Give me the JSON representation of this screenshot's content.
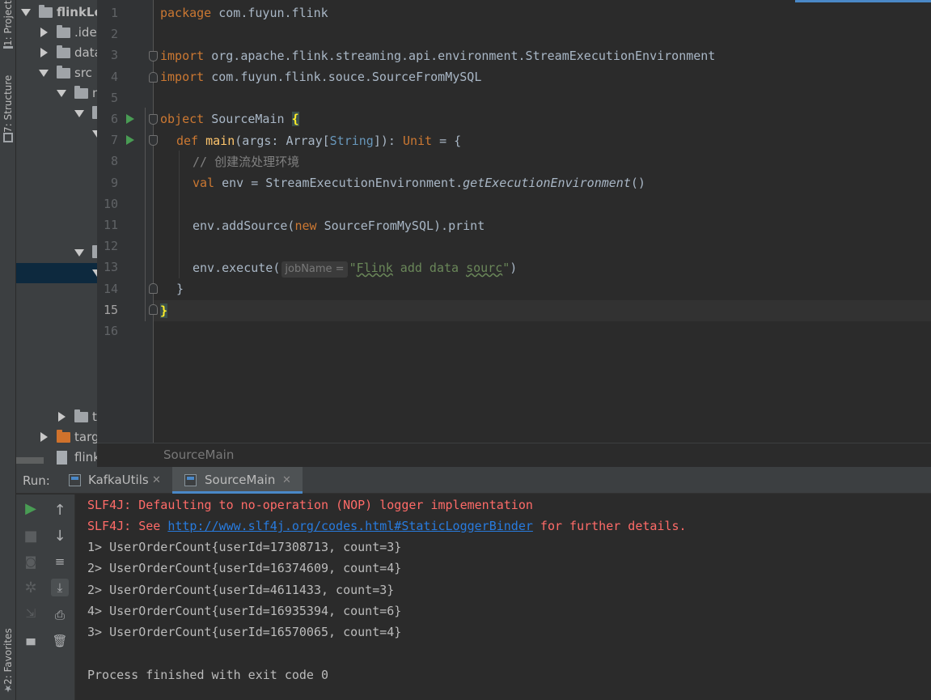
{
  "left_strip": {
    "project_tab": "1: Project",
    "structure_tab": "7: Structure",
    "favorites_tab": "2: Favorites"
  },
  "project_tree": [
    {
      "label": "flinkLe",
      "indent": 0,
      "expanded": true,
      "icon": "folder-icon",
      "bold": true
    },
    {
      "label": ".ide",
      "indent": 1,
      "expanded": false,
      "icon": "folder-icon"
    },
    {
      "label": "data",
      "indent": 1,
      "expanded": false,
      "icon": "folder-icon"
    },
    {
      "label": "src",
      "indent": 1,
      "expanded": true,
      "icon": "folder-icon"
    },
    {
      "label": "m",
      "indent": 2,
      "expanded": true,
      "icon": "folder-icon"
    },
    {
      "label": "",
      "indent": 3,
      "expanded": true,
      "icon": "folder-icon"
    },
    {
      "label": "",
      "indent": 4,
      "expanded": true,
      "icon": "folder-icon"
    },
    {
      "label": "",
      "indent": 3,
      "expanded": true,
      "icon": "folder-icon"
    },
    {
      "label": "",
      "indent": 4,
      "expanded": true,
      "icon": "folder-icon",
      "selected": true
    },
    {
      "label": "t",
      "indent": 2,
      "expanded": false,
      "icon": "folder-icon"
    },
    {
      "label": "targ",
      "indent": 1,
      "expanded": false,
      "icon": "folder-orange-icon"
    },
    {
      "label": "flink",
      "indent": 1,
      "expanded": null,
      "icon": "file-icon"
    }
  ],
  "editor": {
    "file_name": "SourceMain",
    "line_numbers": [
      "1",
      "2",
      "3",
      "4",
      "5",
      "6",
      "7",
      "8",
      "9",
      "10",
      "11",
      "12",
      "13",
      "14",
      "15",
      "16"
    ],
    "current_line": 15,
    "code": {
      "l1_kw": "package ",
      "l1_rest": "com.fuyun.flink",
      "l3_kw": "import ",
      "l3_rest": "org.apache.flink.streaming.api.environment.StreamExecutionEnvironment",
      "l4_kw": "import ",
      "l4_rest": "com.fuyun.flink.souce.SourceFromMySQL",
      "l6_kw": "object ",
      "l6_name": "SourceMain ",
      "l6_brace": "{",
      "l7_kw": "def ",
      "l7_fn": "main",
      "l7_a": "(args: Array[",
      "l7_type": "String",
      "l7_b": "]): ",
      "l7_unit": "Unit",
      "l7_c": " = {",
      "l8_comment": "// 创建流处理环境",
      "l9_kw": "val ",
      "l9_a": "env = StreamExecutionEnvironment.",
      "l9_it": "getExecutionEnvironment",
      "l9_b": "()",
      "l11_a": "env.addSource(",
      "l11_kw": "new ",
      "l11_b": "SourceFromMySQL).print",
      "l13_a": "env.execute(",
      "l13_hint": "jobName =",
      "l13_q1": "\"",
      "l13_s1": "Flink",
      "l13_s2": " add data ",
      "l13_s3": "sourc",
      "l13_q2": "\"",
      "l13_b": ")",
      "l14": "}",
      "l15": "}"
    }
  },
  "run_panel": {
    "label": "Run:",
    "tabs": [
      {
        "label": "KafkaUtils",
        "active": false
      },
      {
        "label": "SourceMain",
        "active": true
      }
    ],
    "console": {
      "line1": "SLF4J: Defaulting to no-operation (NOP) logger implementation",
      "line2_a": "SLF4J: See ",
      "line2_link": "http://www.slf4j.org/codes.html#StaticLoggerBinder",
      "line2_b": " for further details.",
      "output": [
        "1> UserOrderCount{userId=17308713, count=3}",
        "2> UserOrderCount{userId=16374609, count=4}",
        "2> UserOrderCount{userId=4611433, count=3}",
        "4> UserOrderCount{userId=16935394, count=6}",
        "3> UserOrderCount{userId=16570065, count=4}"
      ],
      "exit": "Process finished with exit code 0"
    }
  },
  "colors": {
    "keyword": "#cc7832",
    "function": "#ffc66d",
    "string": "#6a8759",
    "error": "#ff6b68",
    "link": "#287bde",
    "accent": "#4a88c7"
  }
}
